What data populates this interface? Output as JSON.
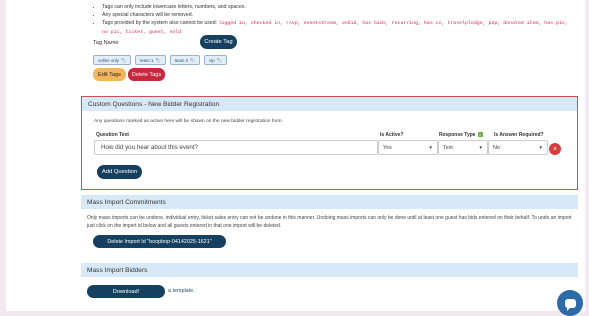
{
  "tags_panel": {
    "rules": [
      "Tags can only include lowercase letters, numbers, and spaces.",
      "Any special characters will be removed.",
      "Tags provided by the system also cannot be used:"
    ],
    "reserved_tags": "logged in, checked in, rsvp, eventstream, unbid, has bids, recurring, has cc, travelpledge, p2p, donated item, has pic, no pic, ticket, guest, sold",
    "tag_name_label": "Tag Name",
    "create_tag_label": "Create Tag",
    "chips": [
      "online only",
      "team 1",
      "team 2",
      "vip"
    ],
    "edit_tags_label": "Edit Tags",
    "delete_tags_label": "Delete Tags"
  },
  "custom_questions": {
    "title": "Custom Questions - New Bidder Registration",
    "description": "Any questions marked as active here will be shown on the new bidder registration form.",
    "col_question": "Question Text",
    "col_active": "Is Active?",
    "col_type": "Response Type",
    "col_type_badge": "i",
    "col_required": "Is Answer Required?",
    "question_value": "How did you hear about this event?",
    "active_value": "Yes",
    "type_value": "Text",
    "required_value": "No",
    "remove_glyph": "×",
    "add_question_label": "Add Question"
  },
  "mass_import_commitments": {
    "title": "Mass Import Commitments",
    "description": "Only mass imports can be undone, individual entry, ticket sales entry can not be undone in this manner. Undoing mass imports can only be done until at least one guest has bids entered on their behalf. To undo an import just click on the import id below and all guests entered in that one import will be deleted.",
    "delete_import_label": "Delete Import Id \"boopbop-04142025-1621\""
  },
  "mass_import_bidders": {
    "title": "Mass Import Bidders",
    "download_label": "Download!",
    "template_prefix": "a",
    "template_link": "template",
    "template_suffix": "."
  },
  "icons": {
    "tag": "tag-icon",
    "chevron": "chevron-down-icon",
    "remove": "close-icon",
    "chat": "chat-icon"
  },
  "colors": {
    "primary": "#16405f",
    "danger": "#c8283d",
    "warning": "#f2b55a",
    "panel_header": "#d7e9f7",
    "highlight_border": "#d05050"
  }
}
